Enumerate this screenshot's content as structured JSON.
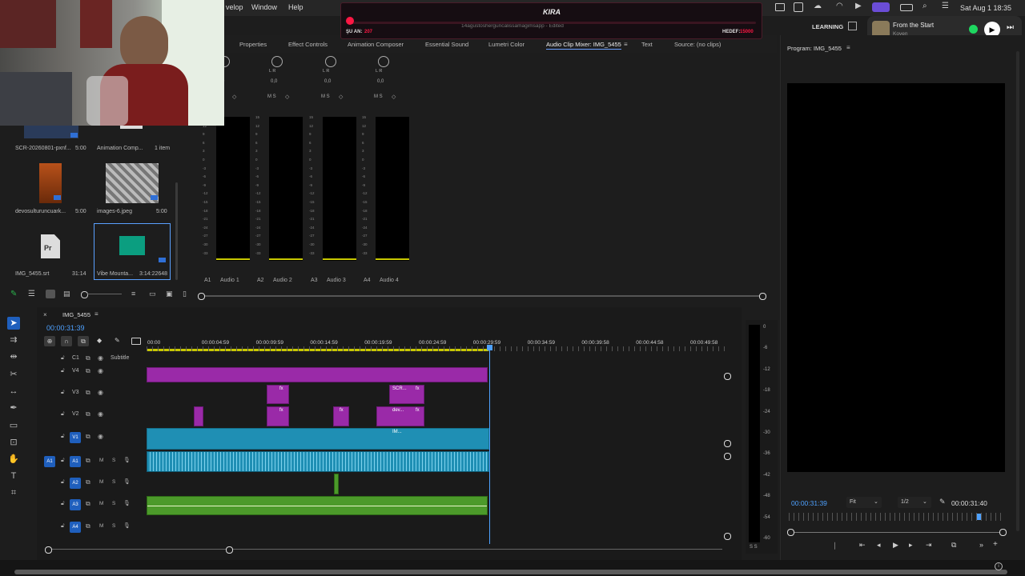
{
  "menubar": {
    "items": [
      "velop",
      "Window",
      "Help"
    ],
    "status": {
      "date_time": "Sat Aug 1  18:35"
    }
  },
  "kira": {
    "title": "KIRA",
    "left_label": "ŞU AN:",
    "left_value": "207",
    "right_label": "HEDEF:",
    "right_value": "15000",
    "progress": 0.014,
    "subtitle": "14agustosherguncalissamagimsapp - Edited"
  },
  "workspace": {
    "label": "LEARNING"
  },
  "now_playing": {
    "title": "From the Start",
    "artist": "Koven"
  },
  "panel_tabs": [
    {
      "label": "Properties"
    },
    {
      "label": "Effect Controls"
    },
    {
      "label": "Animation Composer"
    },
    {
      "label": "Essential Sound"
    },
    {
      "label": "Lumetri Color"
    },
    {
      "label": "Audio Clip Mixer: IMG_5455",
      "active": true
    },
    {
      "label": "Text"
    },
    {
      "label": "Source: (no clips)"
    }
  ],
  "program": {
    "title": "Program: IMG_5455",
    "timecode_left": "00:00:31:39",
    "fit": "Fit",
    "resolution": "1/2",
    "timecode_right": "00:00:31:40"
  },
  "mixer": {
    "channels": [
      {
        "id": "A1",
        "name": "Audio 1",
        "value": "0,0"
      },
      {
        "id": "A2",
        "name": "Audio 2",
        "value": "0,0"
      },
      {
        "id": "A3",
        "name": "Audio 3",
        "value": "0,0"
      },
      {
        "id": "A4",
        "name": "Audio 4",
        "value": "0,0"
      }
    ],
    "pan_lr": "L    R",
    "msb": "M  S",
    "scale": [
      "15",
      "12",
      "9",
      "6",
      "3",
      "0",
      "-3",
      "-6",
      "-9",
      "-12",
      "-15",
      "-18",
      "-21",
      "-24",
      "-27",
      "-30",
      "-33"
    ]
  },
  "project": {
    "items": [
      {
        "name": "SCR-20260801-pxnf...",
        "duration": "5:00"
      },
      {
        "name": "Animation Comp...",
        "duration": "1 item"
      },
      {
        "name": "devosulturuncuark...",
        "duration": "5:00"
      },
      {
        "name": "images-6.jpeg",
        "duration": "5:00"
      },
      {
        "name": "IMG_5455.srt",
        "duration": "31:14",
        "badge": "Pr"
      },
      {
        "name": "Vibe Mounta...",
        "duration": "3:14:22648"
      }
    ]
  },
  "timeline": {
    "sequence": "IMG_5455",
    "timecode": "00:00:31:39",
    "ruler": [
      "00:00",
      "00:00:04:59",
      "00:00:09:59",
      "00:00:14:59",
      "00:00:19:59",
      "00:00:24:59",
      "00:00:29:59",
      "00:00:34:59",
      "00:00:39:58",
      "00:00:44:58",
      "00:00:49:58"
    ],
    "tracks": [
      {
        "id": "C1",
        "name": "Subtitle"
      },
      {
        "id": "V4",
        "name": ""
      },
      {
        "id": "V3",
        "name": ""
      },
      {
        "id": "V2",
        "name": ""
      },
      {
        "id": "V1",
        "name": ""
      },
      {
        "id": "A1",
        "name": ""
      },
      {
        "id": "A2",
        "name": ""
      },
      {
        "id": "A3",
        "name": ""
      },
      {
        "id": "A4",
        "name": ""
      }
    ],
    "clip_labels": {
      "scr": "SCR...",
      "dev": "dev...",
      "img": "IM...",
      "fx": "fx"
    },
    "meter_scale": [
      "0",
      "-6",
      "-12",
      "-18",
      "-24",
      "-30",
      "-36",
      "-42",
      "-48",
      "-54",
      "-60"
    ],
    "meter_bottom": "S S"
  },
  "colors": {
    "accent": "#2680eb",
    "purple_clip": "#9a2aa8",
    "blue_clip": "#1f8fb4",
    "green_clip": "#4c9a2a",
    "kira_red": "#ff1744"
  }
}
